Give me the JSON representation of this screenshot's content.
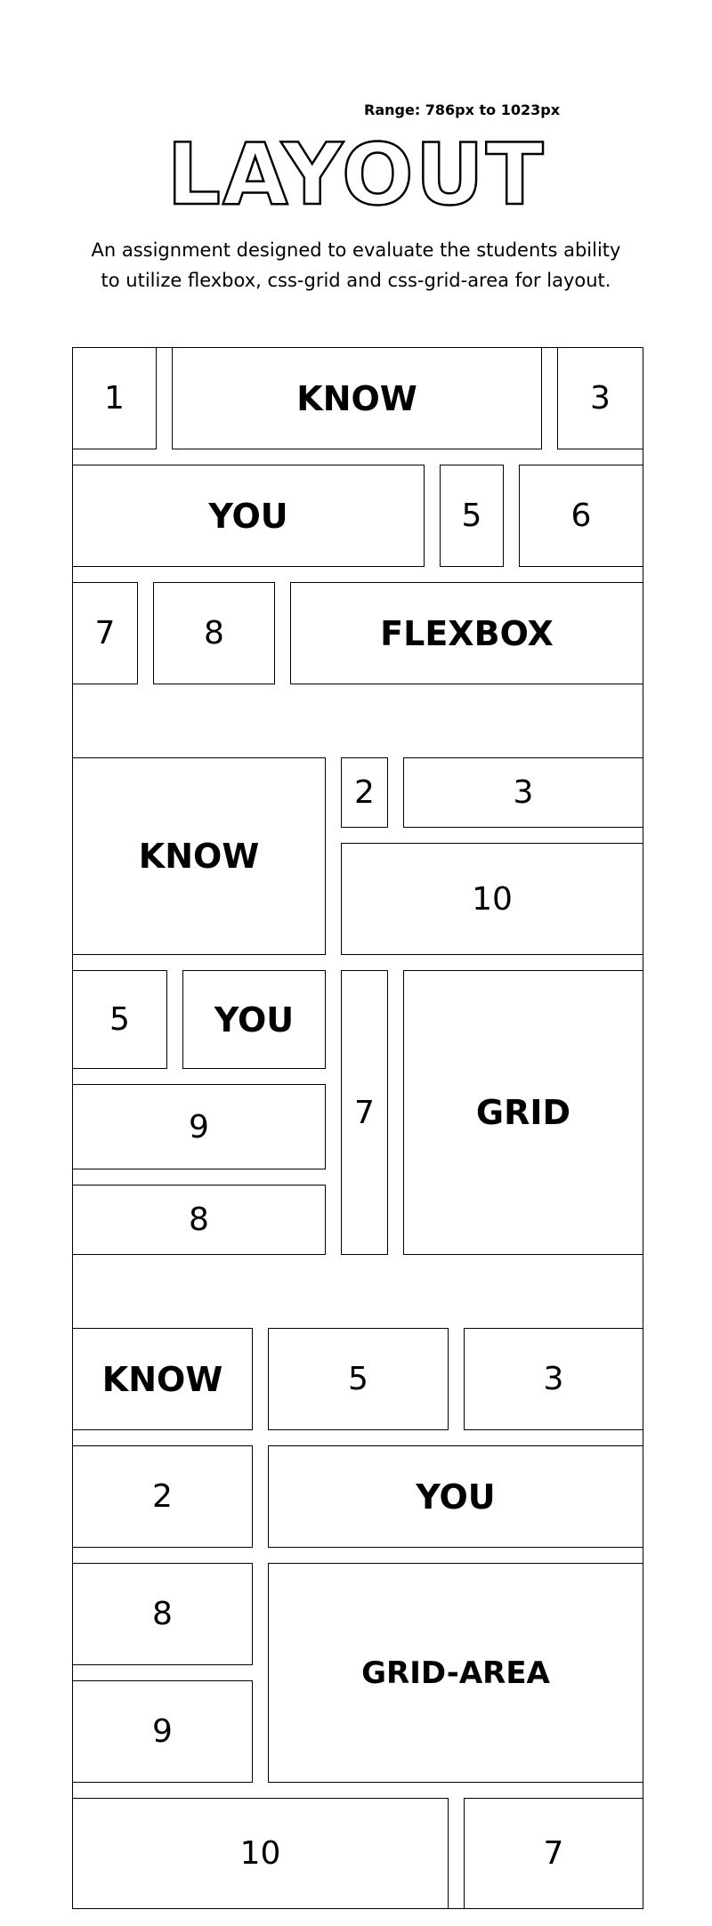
{
  "range_label": "Range: 786px to 1023px",
  "title": "LAYOUT",
  "description": "An assignment designed to evaluate the students ability to utilize flexbox, css-grid and css-grid-area for layout.",
  "flexbox_section": {
    "row1": [
      "1",
      "KNOW",
      "3"
    ],
    "row2": [
      "YOU",
      "5",
      "6"
    ],
    "row3": [
      "7",
      "8",
      "FLEXBOX"
    ]
  },
  "grid_section": {
    "know": "KNOW",
    "two": "2",
    "three": "3",
    "ten": "10",
    "five": "5",
    "you": "YOU",
    "seven": "7",
    "grid": "GRID",
    "nine": "9",
    "eight": "8"
  },
  "grid_area_section": {
    "know": "KNOW",
    "five": "5",
    "three": "3",
    "two": "2",
    "you": "YOU",
    "eight": "8",
    "nine": "9",
    "grid_area": "GRID-AREA",
    "ten": "10",
    "seven": "7"
  }
}
